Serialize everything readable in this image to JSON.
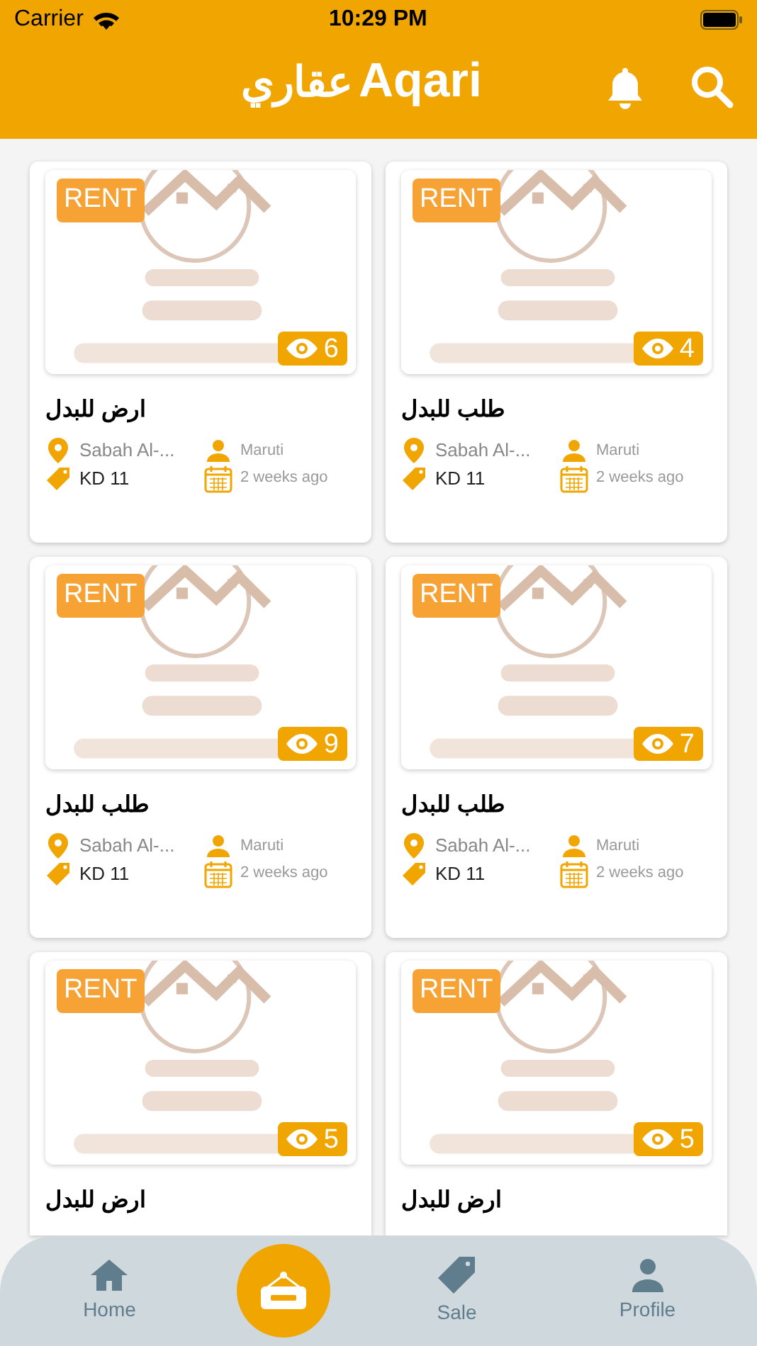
{
  "status_bar": {
    "carrier": "Carrier",
    "time": "10:29 PM"
  },
  "header": {
    "logo_text": "Aqari",
    "logo_arabic": "عقاري"
  },
  "listings": [
    {
      "tag": "RENT",
      "views": "6",
      "title": "ارض للبدل",
      "location": "Sabah Al-...",
      "price": "KD 11",
      "user": "Maruti",
      "time": "2 weeks ago"
    },
    {
      "tag": "RENT",
      "views": "4",
      "title": "طلب للبدل",
      "location": "Sabah Al-...",
      "price": "KD 11",
      "user": "Maruti",
      "time": "2 weeks ago"
    },
    {
      "tag": "RENT",
      "views": "9",
      "title": "طلب للبدل",
      "location": "Sabah Al-...",
      "price": "KD 11",
      "user": "Maruti",
      "time": "2 weeks ago"
    },
    {
      "tag": "RENT",
      "views": "7",
      "title": "طلب للبدل",
      "location": "Sabah Al-...",
      "price": "KD 11",
      "user": "Maruti",
      "time": "2 weeks ago"
    },
    {
      "tag": "RENT",
      "views": "5",
      "title": "ارض للبدل"
    },
    {
      "tag": "RENT",
      "views": "5",
      "title": "ارض للبدل"
    }
  ],
  "tab_bar": [
    {
      "kind": "home",
      "label": "Home",
      "selected": false
    },
    {
      "kind": "rent",
      "selected": true
    },
    {
      "kind": "sale",
      "label": "Sale",
      "selected": false
    },
    {
      "kind": "profile",
      "label": "Profile",
      "selected": false
    }
  ]
}
